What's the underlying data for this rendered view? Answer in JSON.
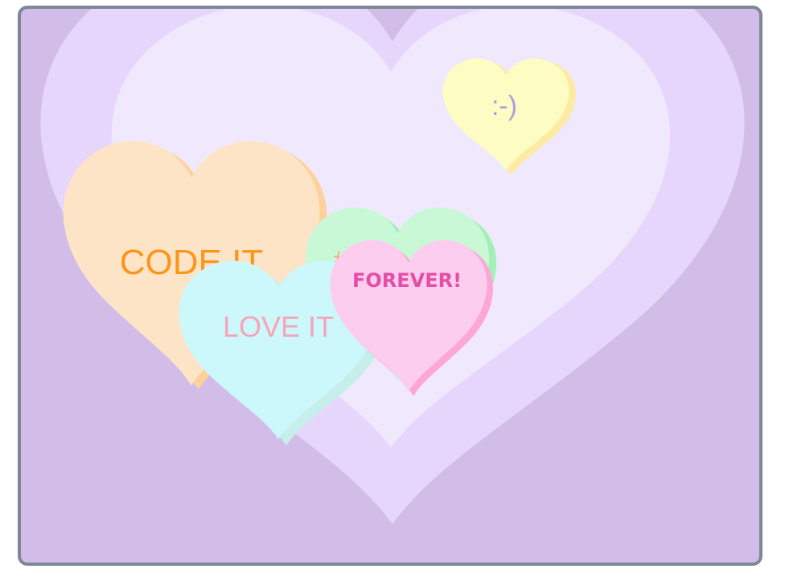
{
  "canvas": {
    "background_color": "#d1bde8",
    "border_color": "#7e8796"
  },
  "big_hearts": {
    "outer_color": "#e7d6fb",
    "inner_color": "#f0e8fd"
  },
  "candy_hearts": [
    {
      "id": "smiley",
      "text": ":-)",
      "face_color": "#fdfcc3",
      "side_color": "#fdeaa3",
      "text_color": "#b49be0"
    },
    {
      "id": "code-it",
      "text": "CODE IT",
      "face_color": "#fee4c7",
      "side_color": "#fed19a",
      "text_color": "#fb961c"
    },
    {
      "id": "hashtag",
      "text": "#",
      "face_color": "#c8f8d6",
      "side_color": "#a2f0b5",
      "text_color": "#f6a67b"
    },
    {
      "id": "love-it",
      "text": "LOVE IT",
      "face_color": "#ccf8fb",
      "side_color": "#c6eeea",
      "text_color": "#f6a4b8"
    },
    {
      "id": "forever",
      "text": "FOREVER!",
      "face_color": "#fdcdef",
      "side_color": "#fca7d6",
      "text_color": "#e34fa5"
    }
  ]
}
